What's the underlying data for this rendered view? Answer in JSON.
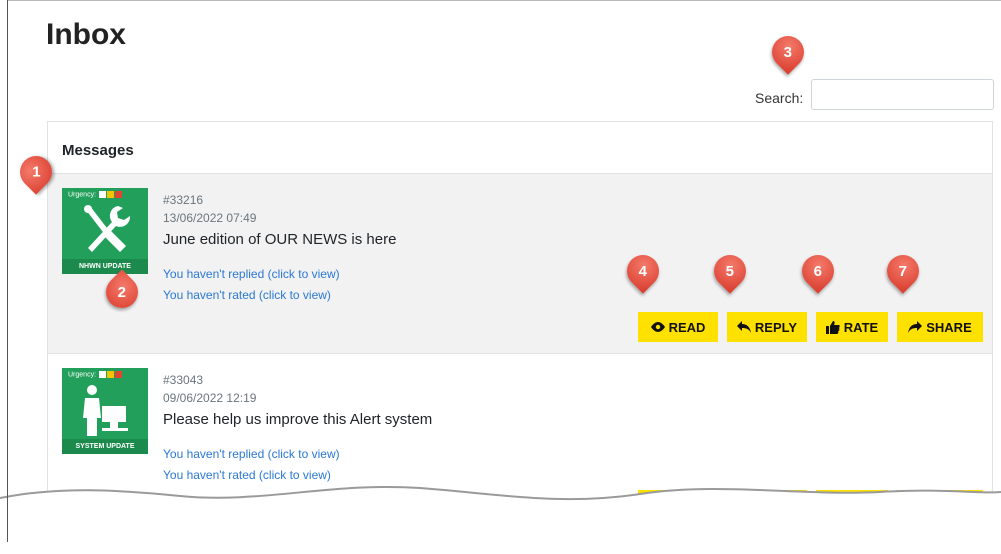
{
  "page": {
    "title": "Inbox"
  },
  "search": {
    "label": "Search:",
    "value": "",
    "placeholder": ""
  },
  "messages_card": {
    "header": "Messages"
  },
  "messages": [
    {
      "urgency_label": "Urgency:",
      "thumb_caption": "NHWN UPDATE",
      "id": "#33216",
      "date": "13/06/2022 07:49",
      "title": "June edition of OUR NEWS is here",
      "reply_status": "You haven't replied (click to view)",
      "rate_status": "You haven't rated (click to view)",
      "icon": "tools-icon"
    },
    {
      "urgency_label": "Urgency:",
      "thumb_caption": "SYSTEM UPDATE",
      "id": "#33043",
      "date": "09/06/2022 12:19",
      "title": "Please help us improve this Alert system",
      "reply_status": "You haven't replied (click to view)",
      "rate_status": "You haven't rated (click to view)",
      "icon": "computer-user-icon"
    }
  ],
  "actions": {
    "read": "READ",
    "reply": "REPLY",
    "rate": "RATE",
    "share": "SHARE"
  },
  "callouts": [
    "1",
    "2",
    "3",
    "4",
    "5",
    "6",
    "7"
  ],
  "colors": {
    "button": "#ffe100",
    "thumb": "#22a05b",
    "link": "#2b78d4",
    "callout": "#d83a2b"
  }
}
